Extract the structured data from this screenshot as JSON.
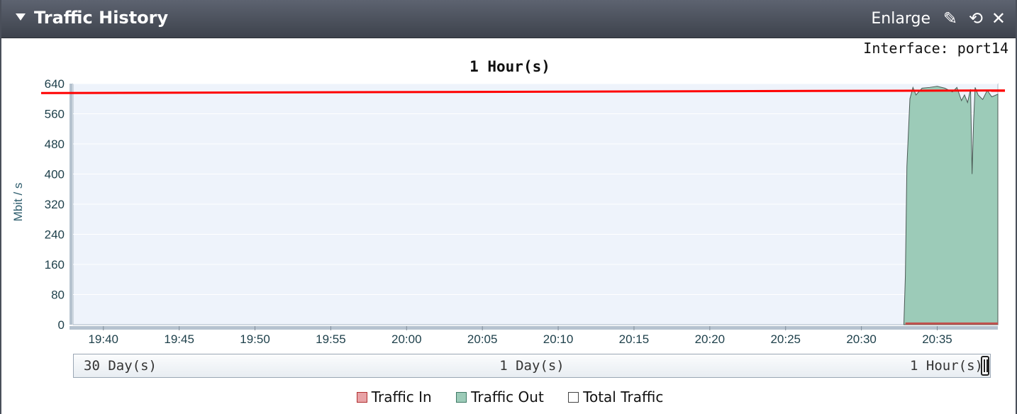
{
  "widget": {
    "title": "Traffic History",
    "enlarge_label": "Enlarge",
    "icons": [
      "collapse-triangle-icon",
      "pencil-icon",
      "refresh-icon",
      "close-icon"
    ]
  },
  "interface_label": "Interface: port14",
  "range_selector": {
    "options": [
      "30 Day(s)",
      "1 Day(s)",
      "1 Hour(s)"
    ],
    "selected": "1 Hour(s)"
  },
  "legend": [
    {
      "label": "Traffic In",
      "color": "#e8a2a6"
    },
    {
      "label": "Traffic Out",
      "color": "#9ccbb8"
    },
    {
      "label": "Total Traffic",
      "color": "#ffffff"
    }
  ],
  "chart_data": {
    "type": "area",
    "title": "1 Hour(s)",
    "ylabel": "Mbit / s",
    "xlabel": "",
    "ylim": [
      0,
      640
    ],
    "yticks": [
      0,
      80,
      160,
      240,
      320,
      400,
      480,
      560,
      640
    ],
    "xlim": [
      "19:38",
      "20:39"
    ],
    "xticks": [
      "19:40",
      "19:45",
      "19:50",
      "19:55",
      "20:00",
      "20:05",
      "20:10",
      "20:15",
      "20:20",
      "20:25",
      "20:30",
      "20:35"
    ],
    "threshold_line": {
      "color": "#ff0000",
      "y_start": 615,
      "y_end": 622
    },
    "grid": true,
    "series": [
      {
        "name": "Traffic In",
        "color": "#c0504d",
        "x": [
          "20:32.9",
          "20:39"
        ],
        "values": [
          3,
          3
        ]
      },
      {
        "name": "Traffic Out",
        "color": "#9ccbb8",
        "x": [
          "20:32.8",
          "20:32.9",
          "20:33.0",
          "20:33.2",
          "20:33.4",
          "20:33.6",
          "20:34.0",
          "20:34.5",
          "20:35.0",
          "20:35.5",
          "20:36.0",
          "20:36.3",
          "20:36.6",
          "20:36.8",
          "20:37.0",
          "20:37.2",
          "20:37.3",
          "20:37.4",
          "20:37.5",
          "20:37.7",
          "20:38.0",
          "20:38.3",
          "20:38.6",
          "20:39"
        ],
        "values": [
          0,
          130,
          420,
          600,
          630,
          610,
          628,
          630,
          633,
          628,
          618,
          630,
          595,
          610,
          590,
          625,
          400,
          540,
          630,
          610,
          598,
          622,
          605,
          612
        ]
      }
    ],
    "legend_position": "bottom"
  }
}
